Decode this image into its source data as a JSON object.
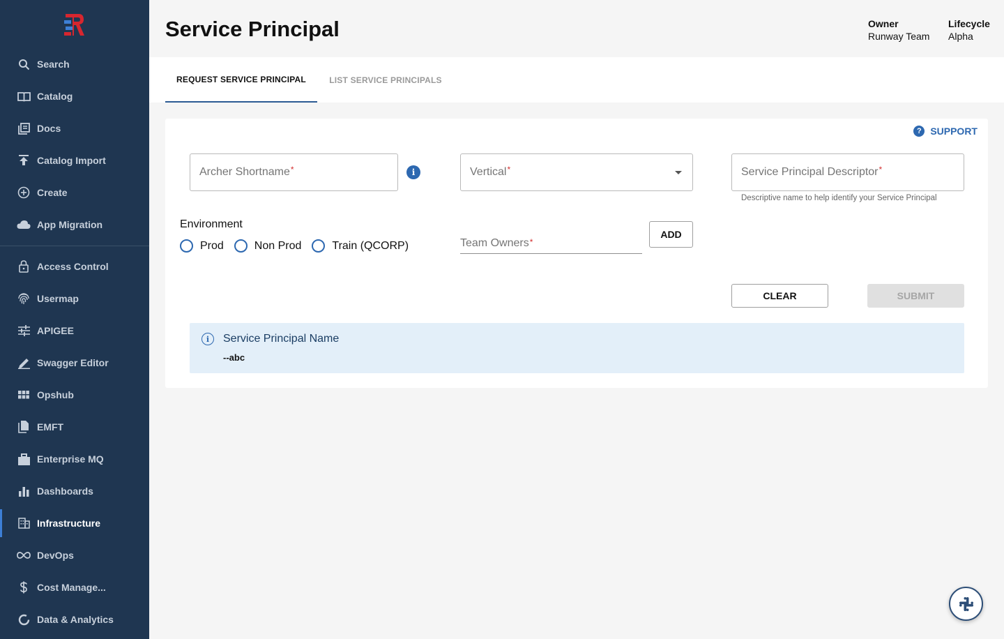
{
  "sidebar": {
    "items": [
      {
        "label": "Search",
        "icon": "search-icon"
      },
      {
        "label": "Catalog",
        "icon": "book-icon"
      },
      {
        "label": "Docs",
        "icon": "docs-icon"
      },
      {
        "label": "Catalog Import",
        "icon": "upload-icon"
      },
      {
        "label": "Create",
        "icon": "plus-circle-icon"
      },
      {
        "label": "App Migration",
        "icon": "cloud-icon"
      },
      {
        "label": "Access Control",
        "icon": "lock-icon"
      },
      {
        "label": "Usermap",
        "icon": "fingerprint-icon"
      },
      {
        "label": "APIGEE",
        "icon": "sliders-icon"
      },
      {
        "label": "Swagger Editor",
        "icon": "pencil-icon"
      },
      {
        "label": "Opshub",
        "icon": "grid-icon"
      },
      {
        "label": "EMFT",
        "icon": "files-icon"
      },
      {
        "label": "Enterprise MQ",
        "icon": "inbox-icon"
      },
      {
        "label": "Dashboards",
        "icon": "bar-chart-icon"
      },
      {
        "label": "Infrastructure",
        "icon": "building-icon",
        "active": true
      },
      {
        "label": "DevOps",
        "icon": "infinity-icon"
      },
      {
        "label": "Cost Manage...",
        "icon": "dollar-icon"
      },
      {
        "label": "Data & Analytics",
        "icon": "donut-icon"
      }
    ]
  },
  "header": {
    "title": "Service Principal",
    "owner_label": "Owner",
    "owner_value": "Runway Team",
    "lifecycle_label": "Lifecycle",
    "lifecycle_value": "Alpha"
  },
  "tabs": [
    {
      "label": "REQUEST SERVICE PRINCIPAL",
      "active": true
    },
    {
      "label": "LIST SERVICE PRINCIPALS",
      "active": false
    }
  ],
  "form": {
    "support_label": "SUPPORT",
    "archer_placeholder": "Archer Shortname",
    "vertical_placeholder": "Vertical",
    "descriptor_placeholder": "Service Principal Descriptor",
    "descriptor_helper": "Descriptive name to help identify your Service Principal",
    "required_mark": "*",
    "environment_label": "Environment",
    "environment_options": [
      "Prod",
      "Non Prod",
      "Train (QCORP)"
    ],
    "team_owners_placeholder": "Team Owners",
    "add_label": "ADD",
    "clear_label": "CLEAR",
    "submit_label": "SUBMIT"
  },
  "notice": {
    "title": "Service Principal Name",
    "value": "--abc"
  },
  "colors": {
    "sidebar_bg": "#1f3651",
    "accent": "#2d68b0",
    "notice_bg": "#e3eff9",
    "required": "#d32f2f"
  }
}
